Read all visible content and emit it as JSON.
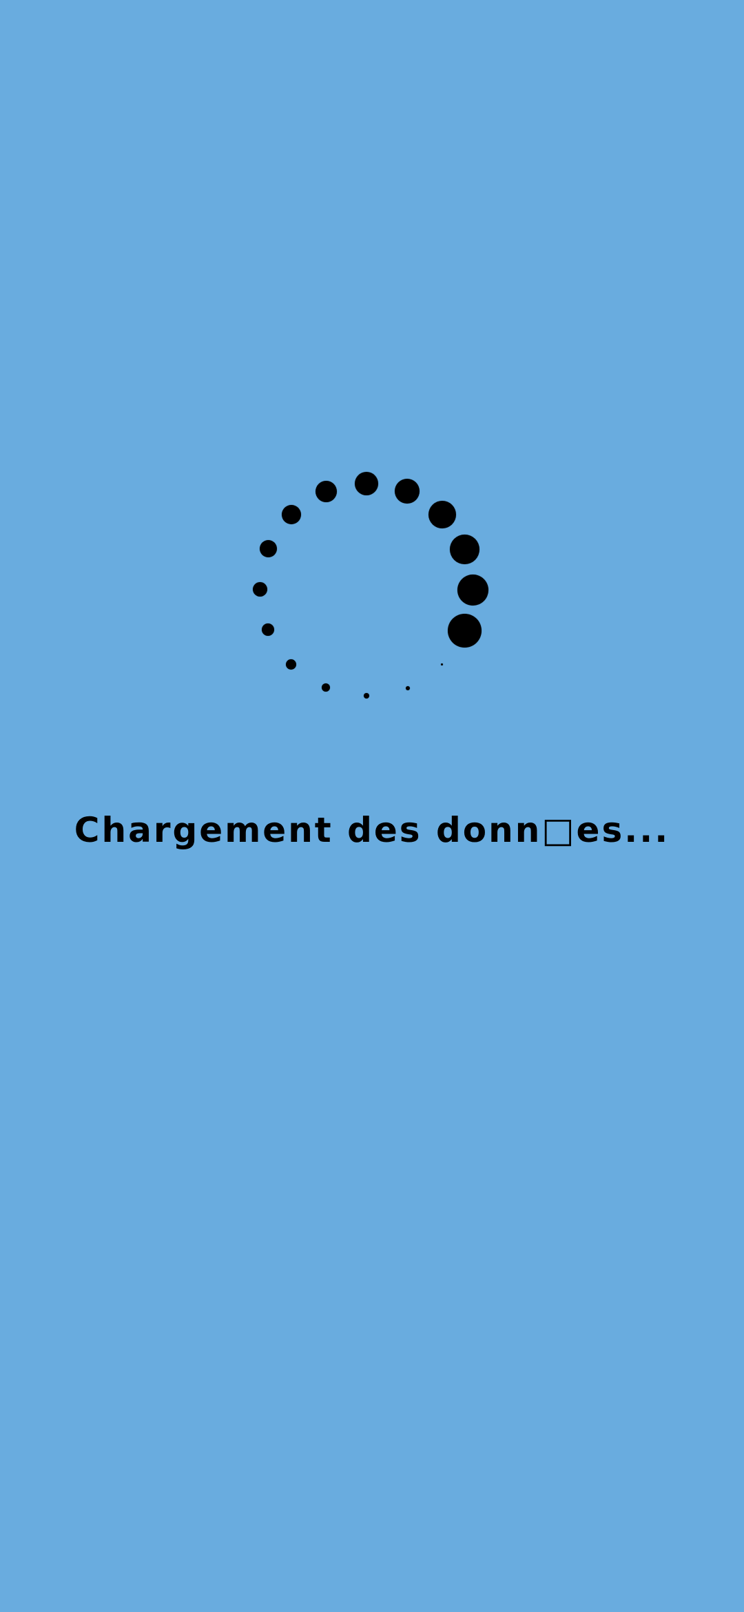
{
  "background_color": "#69acdf",
  "spinner": {
    "icon": "loading-spinner-icon",
    "dot_color": "#000000"
  },
  "loading": {
    "label": "Chargement des donn□es..."
  }
}
